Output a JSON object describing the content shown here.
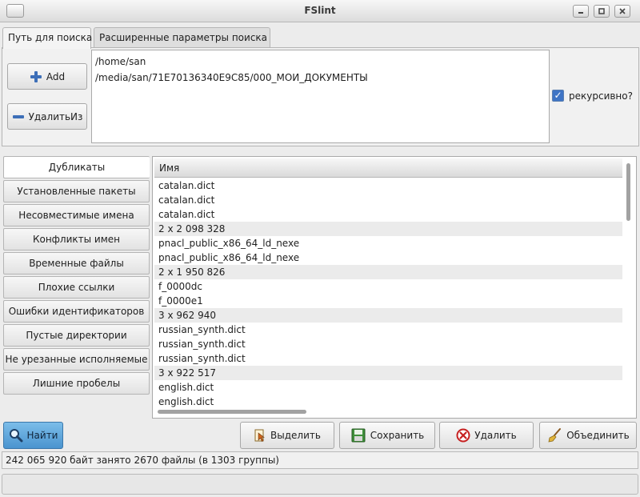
{
  "window": {
    "title": "FSlint",
    "minimize_icon": "minimize-icon",
    "maximize_icon": "maximize-icon",
    "close_icon": "close-icon"
  },
  "tabs": [
    {
      "label": "Путь для поиска",
      "active": true
    },
    {
      "label": "Расширенные параметры поиска",
      "active": false
    }
  ],
  "search_paths": {
    "add_label": "Add",
    "remove_label": "УдалитьИз",
    "paths": [
      "/home/san",
      "/media/san/71E70136340E9C85/000_МОИ_ДОКУМЕНТЫ"
    ],
    "recursive_label": "рекурсивно?",
    "recursive_checked": true
  },
  "categories": [
    {
      "label": "Дубликаты",
      "active": true
    },
    {
      "label": "Установленные пакеты"
    },
    {
      "label": "Несовместимые имена"
    },
    {
      "label": "Конфликты имен"
    },
    {
      "label": "Временные файлы"
    },
    {
      "label": "Плохие ссылки"
    },
    {
      "label": "Ошибки идентификаторов"
    },
    {
      "label": "Пустые директории"
    },
    {
      "label": "Не урезанные исполняемые"
    },
    {
      "label": "Лишние пробелы"
    }
  ],
  "results": {
    "column_header": "Имя",
    "rows": [
      {
        "text": "catalan.dict",
        "group": false
      },
      {
        "text": "catalan.dict",
        "group": false
      },
      {
        "text": "catalan.dict",
        "group": false
      },
      {
        "text": "2 x 2 098 328",
        "group": true
      },
      {
        "text": "pnacl_public_x86_64_ld_nexe",
        "group": false
      },
      {
        "text": "pnacl_public_x86_64_ld_nexe",
        "group": false
      },
      {
        "text": "2 x 1 950 826",
        "group": true
      },
      {
        "text": "f_0000dc",
        "group": false
      },
      {
        "text": "f_0000e1",
        "group": false
      },
      {
        "text": "3 x 962 940",
        "group": true
      },
      {
        "text": "russian_synth.dict",
        "group": false
      },
      {
        "text": "russian_synth.dict",
        "group": false
      },
      {
        "text": "russian_synth.dict",
        "group": false
      },
      {
        "text": "3 x 922 517",
        "group": true
      },
      {
        "text": "english.dict",
        "group": false
      },
      {
        "text": "english.dict",
        "group": false
      }
    ]
  },
  "actions": {
    "find_label": "Найти",
    "select_label": "Выделить",
    "save_label": "Сохранить",
    "delete_label": "Удалить",
    "merge_label": "Объединить"
  },
  "status": {
    "text": "242 065 920 байт занято 2670 файлы (в 1303 группы)"
  },
  "colors": {
    "accent": "#3e74c5",
    "find_button": "#5aa3d8",
    "group_row": "#ebebeb"
  }
}
